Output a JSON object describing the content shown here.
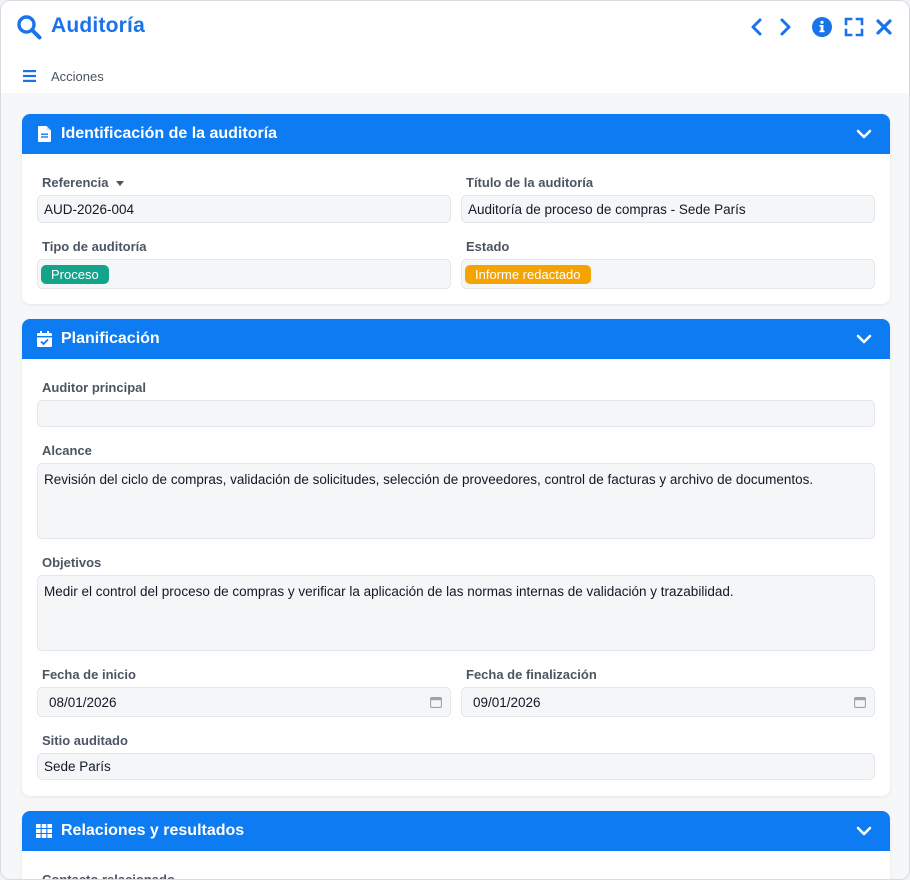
{
  "window": {
    "title": "Auditoría",
    "actions_label": "Acciones"
  },
  "colors": {
    "accent": "#1a73e8",
    "header_bg": "#0d7cf2",
    "tag_process": "#14a38b",
    "tag_status": "#f5a300"
  },
  "identification": {
    "title": "Identificación de la auditoría",
    "reference_label": "Referencia",
    "reference_value": "AUD-2026-004",
    "audit_title_label": "Título de la auditoría",
    "audit_title_value": "Auditoría de proceso de compras - Sede París",
    "type_label": "Tipo de auditoría",
    "type_value": "Proceso",
    "status_label": "Estado",
    "status_value": "Informe redactado"
  },
  "planning": {
    "title": "Planificación",
    "lead_auditor_label": "Auditor principal",
    "lead_auditor_value": "",
    "scope_label": "Alcance",
    "scope_value": "Revisión del ciclo de compras, validación de solicitudes, selección de proveedores, control de facturas y archivo de documentos.",
    "objectives_label": "Objetivos",
    "objectives_value": "Medir el control del proceso de compras y verificar la aplicación de las normas internas de validación y trazabilidad.",
    "start_date_label": "Fecha de inicio",
    "start_date_value": "08/01/2026",
    "end_date_label": "Fecha de finalización",
    "end_date_value": "09/01/2026",
    "site_label": "Sitio auditado",
    "site_value": "Sede París"
  },
  "relations": {
    "title": "Relaciones y resultados",
    "contact_label": "Contacto relacionado"
  }
}
